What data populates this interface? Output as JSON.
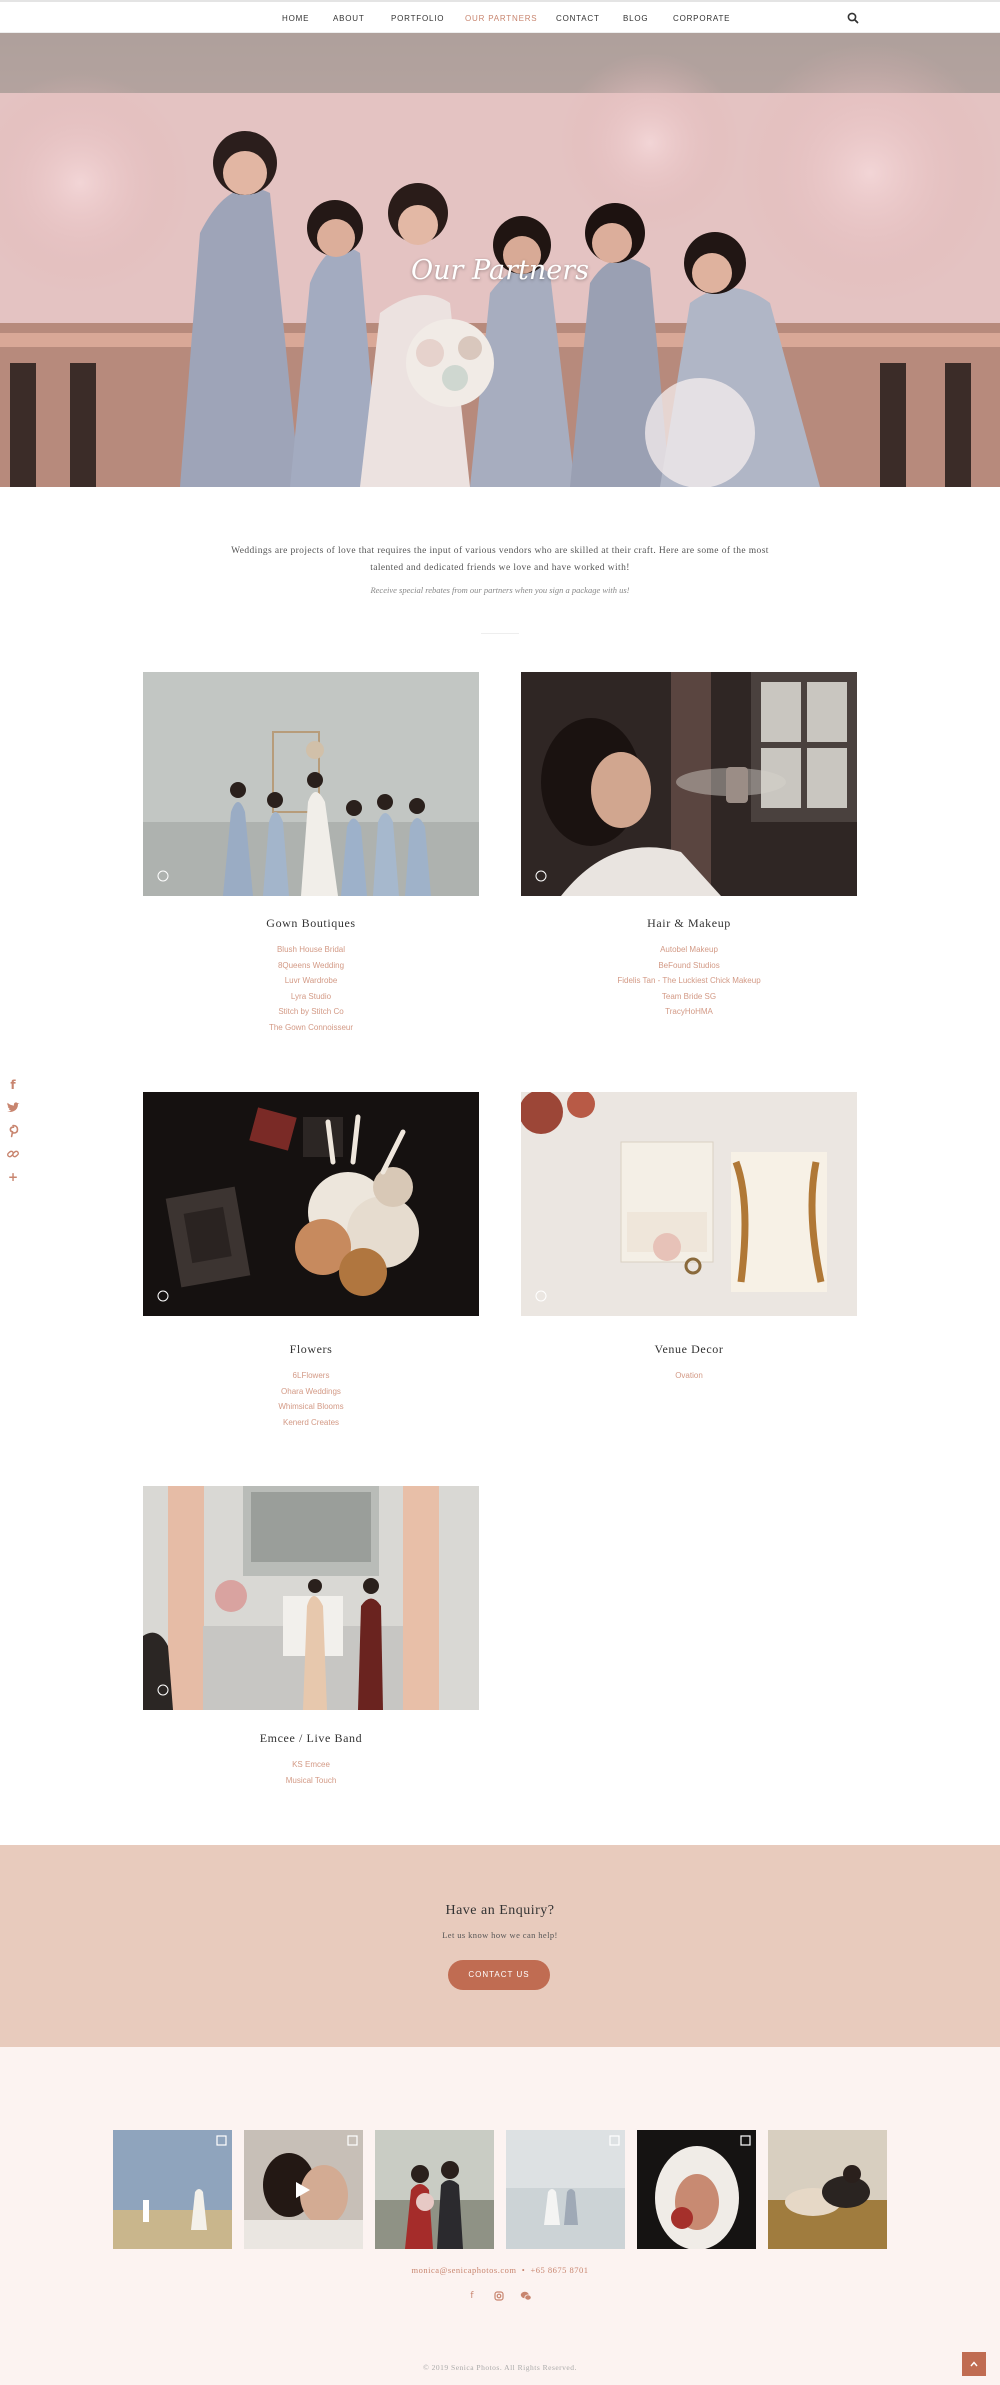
{
  "nav": {
    "items": [
      {
        "label": "HOME"
      },
      {
        "label": "ABOUT"
      },
      {
        "label": "PORTFOLIO"
      },
      {
        "label": "OUR PARTNERS",
        "active": true
      },
      {
        "label": "CONTACT"
      },
      {
        "label": "BLOG"
      },
      {
        "label": "CORPORATE"
      }
    ],
    "search_icon": "search-icon"
  },
  "hero": {
    "title": "Our Partners"
  },
  "intro": {
    "text": "Weddings are projects of love that requires the input of various vendors who are skilled at their craft. Here are some of the most talented and dedicated friends we love and have worked with!",
    "note": "Receive special rebates from our partners when you sign a package with us!"
  },
  "partners": [
    {
      "title": "Gown Boutiques",
      "links": [
        "Blush House Bridal",
        "8Queens Wedding",
        "Luvr Wardrobe",
        "Lyra Studio",
        "Stitch by Stitch Co",
        "The Gown Connoisseur"
      ]
    },
    {
      "title": "Hair & Makeup",
      "links": [
        "Autobel Makeup",
        "BeFound Studios",
        "Fidelis Tan - The Luckiest Chick Makeup",
        "Team Bride SG",
        "TracyHoHMA"
      ]
    },
    {
      "title": "Flowers",
      "links": [
        "6LFlowers",
        "Ohara Weddings",
        "Whimsical Blooms",
        "Kenerd Creates"
      ]
    },
    {
      "title": "Venue Decor",
      "links": [
        "Ovation"
      ]
    },
    {
      "title": "Emcee / Live Band",
      "links": [
        "KS Emcee",
        "Musical Touch"
      ]
    }
  ],
  "side_social": [
    "facebook-icon",
    "twitter-icon",
    "pinterest-icon",
    "link-icon",
    "plus-icon"
  ],
  "enquiry": {
    "title": "Have an Enquiry?",
    "subtitle": "Let us know how we can help!",
    "button": "CONTACT US"
  },
  "footer": {
    "email": "monica@senicaphotos.com",
    "separator": "•",
    "phone": "+65 8675 8701",
    "icons": [
      "facebook-icon",
      "instagram-icon",
      "wechat-icon"
    ],
    "copyright": "© 2019 Senica Photos. All Rights Reserved."
  },
  "colors": {
    "accent": "#c8856f",
    "button": "#c06c52",
    "enquiry_bg": "#e8cbbd",
    "footer_bg": "#fcf3f1",
    "link": "#d39a86"
  }
}
